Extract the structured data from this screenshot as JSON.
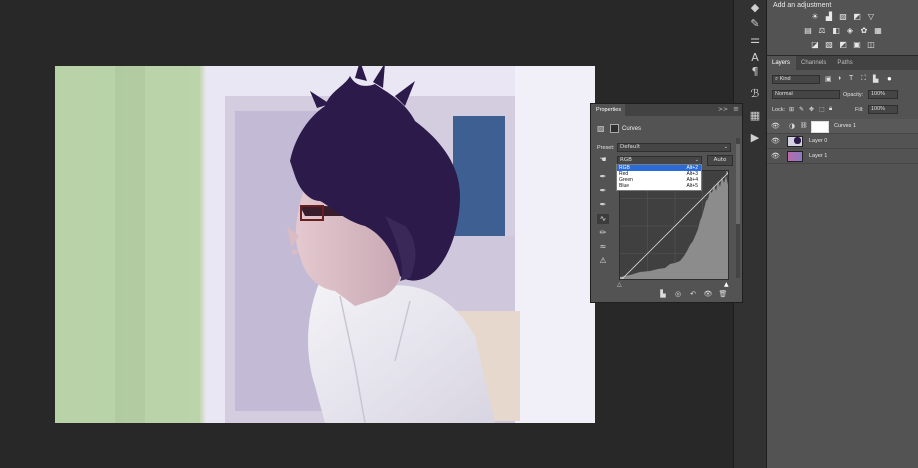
{
  "adjustments": {
    "title": "Add an adjustment",
    "row1": [
      "brightness-icon",
      "levels-icon",
      "curves-icon",
      "exposure-icon",
      "vibrance-icon"
    ],
    "row2": [
      "hue-saturation-icon",
      "color-balance-icon",
      "black-white-icon",
      "photo-filter-icon",
      "channel-mixer-icon",
      "color-lookup-icon"
    ],
    "row3": [
      "invert-icon",
      "posterize-icon",
      "threshold-icon",
      "gradient-map-icon",
      "selective-color-icon"
    ]
  },
  "layers": {
    "tabs": [
      "Layers",
      "Channels",
      "Paths"
    ],
    "kind_filter": "Kind",
    "blend_mode": "Normal",
    "opacity_label": "Opacity:",
    "opacity_value": "100%",
    "lock_label": "Lock:",
    "fill_label": "Fill:",
    "fill_value": "100%",
    "items": [
      {
        "name": "Curves 1",
        "selected": true
      },
      {
        "name": "Layer 0",
        "selected": false
      },
      {
        "name": "Layer 1",
        "selected": false
      }
    ]
  },
  "properties": {
    "tab": "Properties",
    "collapse": ">>",
    "menu": "≡",
    "title": "Curves",
    "preset_label": "Preset:",
    "preset_value": "Default",
    "channel_value": "RGB",
    "auto_label": "Auto",
    "channel_options": [
      {
        "label": "RGB",
        "shortcut": "Alt+2",
        "selected": true
      },
      {
        "label": "Red",
        "shortcut": "Alt+3",
        "selected": false
      },
      {
        "label": "Green",
        "shortcut": "Alt+4",
        "selected": false
      },
      {
        "label": "Blue",
        "shortcut": "Alt+5",
        "selected": false
      }
    ]
  },
  "colors": {
    "panel": "#535353",
    "dark": "#282828",
    "selection": "#2a6bd8",
    "hair": "#2b1a4a"
  }
}
